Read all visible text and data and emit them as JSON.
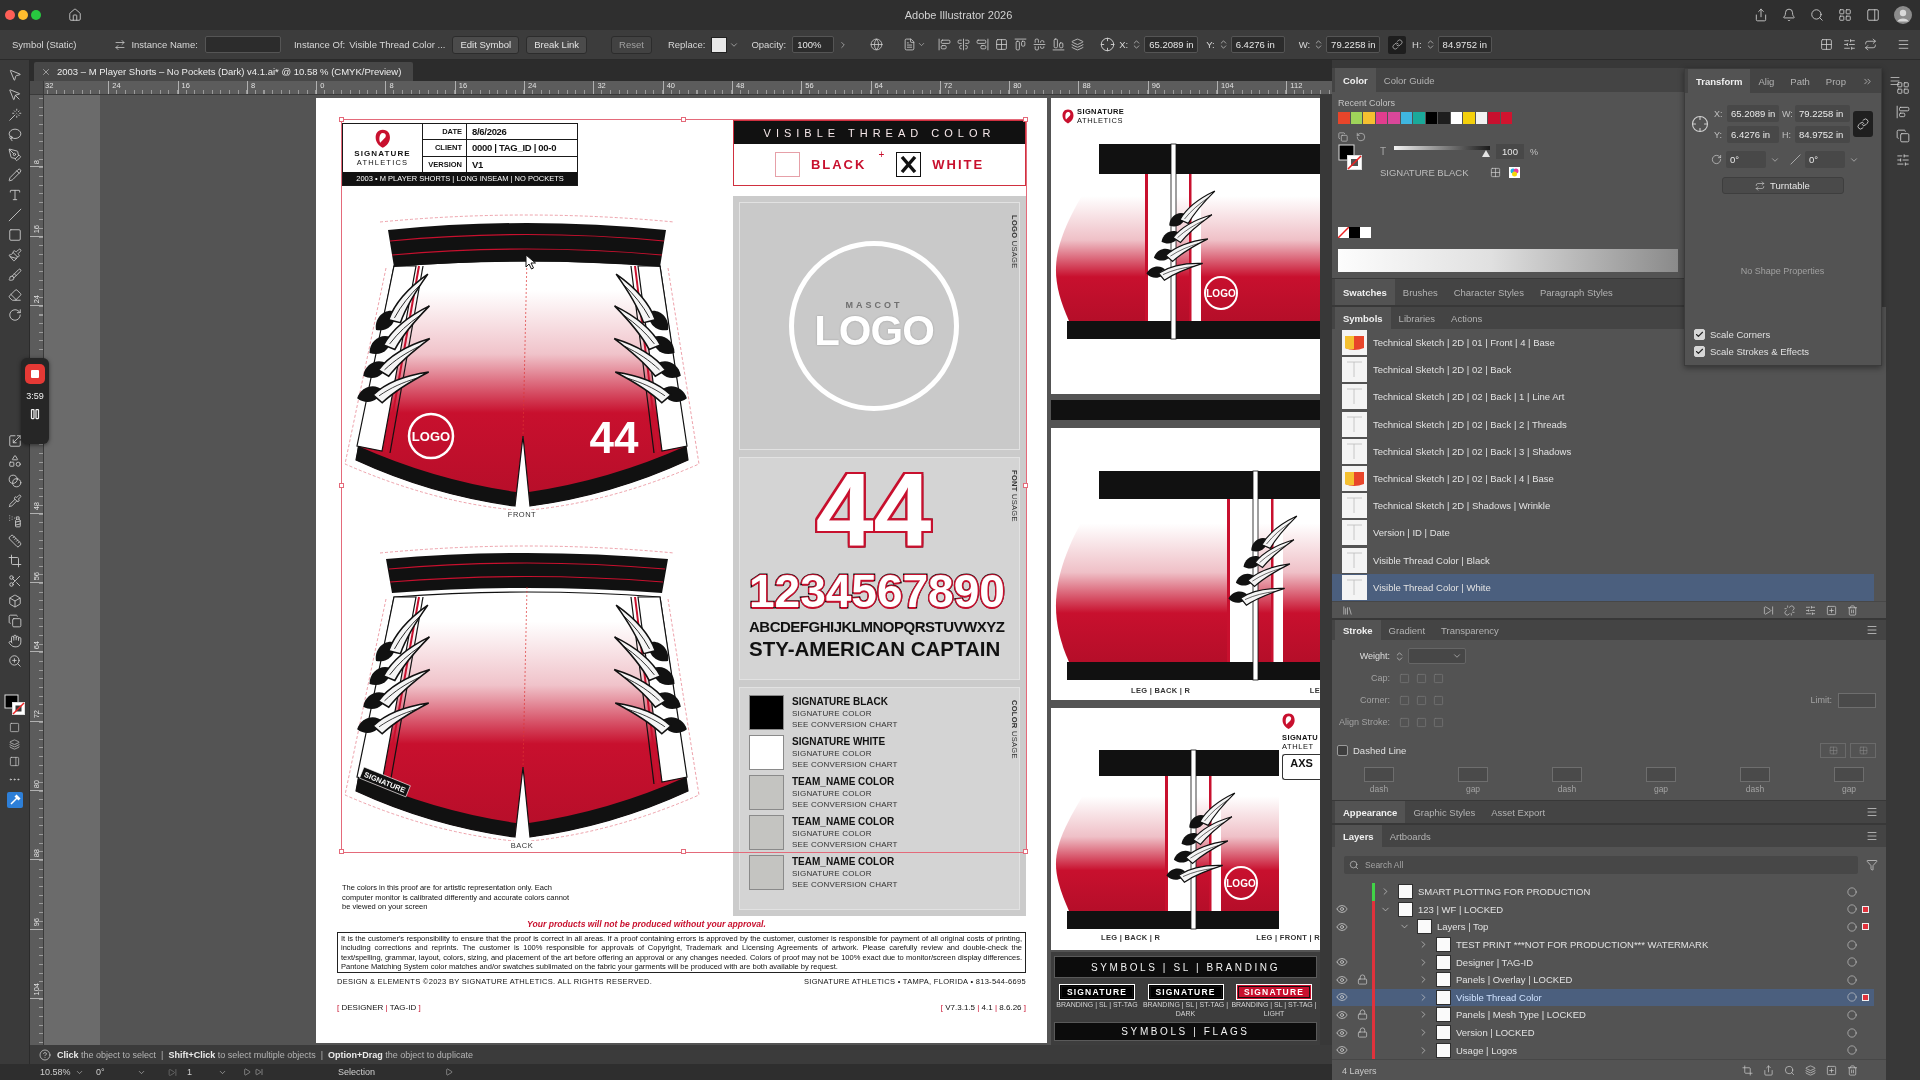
{
  "app": {
    "title": "Adobe Illustrator 2026"
  },
  "control_bar": {
    "selection_type": "Symbol (Static)",
    "instance_name_label": "Instance Name:",
    "instance_of_label": "Instance Of:",
    "instance_of": "Visible Thread Color ...",
    "buttons": [
      {
        "label": "Edit Symbol",
        "disabled": false
      },
      {
        "label": "Break Link",
        "disabled": false
      },
      {
        "label": "Reset",
        "disabled": true
      }
    ],
    "replace_label": "Replace:",
    "opacity_label": "Opacity:",
    "opacity": "100%",
    "coords": [
      {
        "label": "X:",
        "value": "65.2089 in"
      },
      {
        "label": "Y:",
        "value": "6.4276 in"
      },
      {
        "label": "W:",
        "value": "79.2258 in"
      },
      {
        "label": "H:",
        "value": "84.9752 in"
      }
    ],
    "proportions_linked": true
  },
  "document_tab": {
    "title": "2003 – M Player Shorts – No Pockets (Dark) v4.1.ai* @ 10.58 % (CMYK/Preview)",
    "selected": true
  },
  "rulers": {
    "horizontal": [
      "32",
      "24",
      "16",
      "8",
      "0",
      "8",
      "16",
      "24",
      "32",
      "40",
      "48",
      "56",
      "64",
      "72",
      "80",
      "88",
      "96",
      "104",
      "112"
    ],
    "vertical_upper": [
      "8",
      "16",
      "24"
    ],
    "vertical_lower": [
      "48",
      "56",
      "64",
      "72",
      "80",
      "88",
      "96",
      "104"
    ]
  },
  "recorder": {
    "time": "3:59"
  },
  "artboard": {
    "header": {
      "brand_name": "SIGNATURE",
      "brand_sub": "ATHLETICS",
      "fields": [
        {
          "label": "DATE",
          "value": "8/6/2026"
        },
        {
          "label": "CLIENT",
          "value": "0000 | TAG_ID | 00-0"
        },
        {
          "label": "VERSION",
          "value": "V1"
        }
      ],
      "product": "2003 • M PLAYER SHORTS | LONG INSEAM | NO POCKETS"
    },
    "thread_color": {
      "title": "VISIBLE THREAD COLOR",
      "options": [
        {
          "label": "BLACK",
          "checked": false
        },
        {
          "label": "WHITE",
          "checked": true
        }
      ],
      "joiner": "+"
    },
    "sketches": [
      {
        "kind": "front",
        "label": "FRONT",
        "logo": "LOGO",
        "number": "44"
      },
      {
        "kind": "back",
        "label": "BACK",
        "tag": "SIGNATURE"
      }
    ],
    "usage": {
      "logo": {
        "label": "**LOGO** USAGE",
        "mascot": "MASCOT",
        "text": "LOGO"
      },
      "font": {
        "label": "**FONT** USAGE",
        "number": "44",
        "digits": "1234567890",
        "alphabet": "ABCDEFGHIJKLMNOPQRSTUVWXYZ",
        "name": "STY-AMERICAN CAPTAIN"
      },
      "color": {
        "label": "**COLOR** USAGE",
        "entries": [
          {
            "name": "SIGNATURE BLACK",
            "color": "#000000",
            "type": "SIGNATURE COLOR",
            "note": "SEE CONVERSION CHART"
          },
          {
            "name": "SIGNATURE WHITE",
            "color": "#ffffff",
            "type": "SIGNATURE COLOR",
            "note": "SEE CONVERSION CHART"
          },
          {
            "name": "TEAM_NAME COLOR",
            "color": "#c4c4c1",
            "type": "SIGNATURE COLOR",
            "note": "SEE CONVERSION CHART"
          },
          {
            "name": "TEAM_NAME COLOR",
            "color": "#c4c4c1",
            "type": "SIGNATURE COLOR",
            "note": "SEE CONVERSION CHART"
          },
          {
            "name": "TEAM_NAME COLOR",
            "color": "#c4c4c1",
            "type": "SIGNATURE COLOR",
            "note": "SEE CONVERSION CHART"
          }
        ]
      }
    },
    "note": "The colors in this proof are for artistic representation only. Each computer monitor is calibrated differently and accurate colors cannot be viewed on your screen",
    "approval": "Your products will not be produced without your approval.",
    "disclaimer": "It is the customer's responsibility to ensure that the proof is correct in all areas. If a proof containing errors is approved by the customer, customer is responsible for payment of all original costs of printing, including corrections and reprints. The customer is 100% responsible for approvals of Copyright, Trademark and Licensing Agreements of artwork. Please carefully review and double-check the text/spelling, grammar, layout, colors, sizing, and placement of the art before offering an approval or any changes needed.  Colors of proof may not be 100% exact due to monitor/screen display differences. Pantone Matching System color matches and/or swatches sublimated on the fabric your garments will be produced with are both available by request.",
    "rights": "DESIGN & ELEMENTS ©2023 BY SIGNATURE ATHLETICS. ALL RIGHTS RESERVED.",
    "contact": "SIGNATURE ATHLETICS • TAMPA, FLORIDA • 813-544-6695",
    "designer_tag": {
      "open": "[",
      "close": "]",
      "separator": "|",
      "parts": [
        "DESIGNER",
        "TAG-ID"
      ]
    },
    "version_tag": {
      "open": "[",
      "close": "]",
      "separator": "|",
      "parts": [
        "V7.3.1.5",
        "4.1",
        "8.6.26"
      ]
    }
  },
  "previews": [
    {
      "kind": "front",
      "brand_name": "SIGNATURE",
      "brand_sub": "ATHLETICS",
      "logo": "LOGO"
    },
    {
      "kind": "back",
      "labels": [
        "LEG | BACK | R",
        "LE"
      ]
    },
    {
      "kind": "pair",
      "brand_name": "SIGNATU",
      "brand_sub": "ATHLET",
      "badge": "AXS",
      "logo": "LOGO",
      "labels": [
        "LEG | BACK | R",
        "LEG | FRONT | R"
      ]
    }
  ],
  "symbol_sheet": {
    "branding_title": "SYMBOLS | SL | BRANDING",
    "badges": [
      {
        "text": "SIGNATURE",
        "color": "#000000",
        "caption": "BRANDING | SL | ST-TAG"
      },
      {
        "text": "SIGNATURE",
        "color": "#000000",
        "caption": "BRANDING | SL | ST-TAG | DARK"
      },
      {
        "text": "SIGNATURE",
        "color": "#c8102e",
        "caption": "BRANDING | SL | ST-TAG | LIGHT"
      }
    ],
    "flags_title": "SYMBOLS | FLAGS"
  },
  "hint_bar": {
    "text": "**Click** the object to select  |  **Shift+Click** to select multiple objects  |  **Option+Drag** the object to duplicate"
  },
  "status_bar": {
    "zoom": "10.58%",
    "rotation": "0°",
    "artboard": "1",
    "tool": "Selection"
  },
  "color_panel": {
    "tabs": [
      {
        "label": "Color",
        "selected": true
      },
      {
        "label": "Color Guide",
        "selected": false
      }
    ],
    "recent_label": "Recent Colors",
    "recent_colors": [
      {
        "color": "#e8452a"
      },
      {
        "color": "#9fd35a"
      },
      {
        "color": "#f5c030"
      },
      {
        "color": "#e23d8e"
      },
      {
        "color": "#d9479a"
      },
      {
        "color": "#3fb6e0"
      },
      {
        "color": "#1aa99a"
      },
      {
        "color": "#000000"
      },
      {
        "color": "#1e1e1e"
      },
      {
        "color": "#ffffff"
      },
      {
        "color": "#f4d00c"
      },
      {
        "color": "#f2f2f2"
      },
      {
        "color": "#c8102e"
      },
      {
        "color": "#d0142f"
      }
    ],
    "tint": {
      "label": "T",
      "level": 1,
      "value": "100",
      "unit": "%"
    },
    "swatch_name": "SIGNATURE BLACK"
  },
  "swatches_tabs": [
    {
      "label": "Swatches",
      "selected": true
    },
    {
      "label": "Brushes",
      "selected": false
    },
    {
      "label": "Character Styles",
      "selected": false
    },
    {
      "label": "Paragraph Styles",
      "selected": false
    }
  ],
  "symbols_panel": {
    "tabs": [
      {
        "label": "Symbols",
        "selected": true
      },
      {
        "label": "Libraries",
        "selected": false
      },
      {
        "label": "Actions",
        "selected": false
      }
    ],
    "items": [
      {
        "name": "Technical Sketch | 2D | 01 | Front | 4 | Base",
        "kind": "color",
        "selected": false
      },
      {
        "name": "Technical Sketch | 2D | 02 | Back",
        "kind": "sketch",
        "selected": false
      },
      {
        "name": "Technical Sketch | 2D | 02 | Back | 1 | Line Art",
        "kind": "sketch",
        "selected": false
      },
      {
        "name": "Technical Sketch | 2D | 02 | Back | 2 | Threads",
        "kind": "sketch",
        "selected": false
      },
      {
        "name": "Technical Sketch | 2D | 02 | Back | 3 | Shadows",
        "kind": "sketch",
        "selected": false
      },
      {
        "name": "Technical Sketch | 2D | 02 | Back | 4 | Base",
        "kind": "color",
        "selected": false
      },
      {
        "name": "Technical Sketch | 2D | Shadows | Wrinkle",
        "kind": "sketch",
        "selected": false
      },
      {
        "name": "Version | ID | Date",
        "kind": "sketch",
        "selected": false
      },
      {
        "name": "Visible Thread Color | Black",
        "kind": "sketch",
        "selected": false
      },
      {
        "name": "Visible Thread Color | White",
        "kind": "sketch",
        "selected": true
      }
    ]
  },
  "transform_panel": {
    "tabs": [
      {
        "label": "Transform",
        "selected": true
      },
      {
        "label": "Alig",
        "selected": false
      },
      {
        "label": "Path",
        "selected": false
      },
      {
        "label": "Prop",
        "selected": false
      }
    ],
    "fields": [
      {
        "label": "X:",
        "value": "65.2089 in"
      },
      {
        "label": "W:",
        "value": "79.2258 in"
      },
      {
        "label": "Y:",
        "value": "6.4276 in"
      },
      {
        "label": "H:",
        "value": "84.9752 in"
      }
    ],
    "proportions_linked": true,
    "angle": "0°",
    "shear": "0°",
    "turntable": "Turntable",
    "empty_note": "No Shape Properties",
    "options": [
      {
        "label": "Scale Corners",
        "checked": true
      },
      {
        "label": "Scale Strokes & Effects",
        "checked": true
      }
    ]
  },
  "stroke_panel": {
    "tabs": [
      {
        "label": "Stroke",
        "selected": true
      },
      {
        "label": "Gradient",
        "selected": false
      },
      {
        "label": "Transparency",
        "selected": false
      }
    ],
    "weight_label": "Weight:",
    "rows": [
      {
        "label": "Cap:",
        "disabled": true
      },
      {
        "label": "Corner:",
        "disabled": true
      },
      {
        "label": "Align Stroke:",
        "disabled": true
      }
    ],
    "limit": {
      "label": "Limit:",
      "disabled": true
    },
    "dashed": {
      "label": "Dashed Line",
      "checked": false
    },
    "dash_fields": [
      {
        "label": "dash",
        "disabled": true
      },
      {
        "label": "gap",
        "disabled": true
      },
      {
        "label": "dash",
        "disabled": true
      },
      {
        "label": "gap",
        "disabled": true
      },
      {
        "label": "dash",
        "disabled": true
      },
      {
        "label": "gap",
        "disabled": true
      }
    ]
  },
  "appearance_tabs": [
    {
      "label": "Appearance",
      "selected": true
    },
    {
      "label": "Graphic Styles",
      "selected": false
    },
    {
      "label": "Asset Export",
      "selected": false
    }
  ],
  "layers_panel": {
    "tabs": [
      {
        "label": "Layers",
        "selected": true
      },
      {
        "label": "Artboards",
        "selected": false
      }
    ],
    "search_placeholder": "Search All",
    "layers": [
      {
        "name": "SMART PLOTTING FOR PRODUCTION",
        "color": "#41d447",
        "visible": false,
        "locked": false,
        "expanded": false,
        "selected": false,
        "selection_mark": false
      },
      {
        "name": "123 | WF | LOCKED",
        "color": "#e0323c",
        "visible": true,
        "locked": false,
        "expanded": true,
        "selected": false,
        "selection_mark": true,
        "children": [
          {
            "name": "Layers | Top",
            "visible": true,
            "locked": false,
            "expanded": true,
            "selected": false,
            "selection_mark": true,
            "children": [
              {
                "name": "TEST PRINT ***NOT FOR PRODUCTION*** WATERMARK",
                "visible": false,
                "locked": false,
                "expanded": false,
                "selected": false,
                "selection_mark": false
              },
              {
                "name": "Designer | TAG-ID",
                "visible": true,
                "locked": false,
                "expanded": false,
                "selected": false,
                "selection_mark": false
              },
              {
                "name": "Panels | Overlay | LOCKED",
                "visible": true,
                "locked": true,
                "expanded": false,
                "selected": false,
                "selection_mark": false
              },
              {
                "name": "Visible Thread Color",
                "visible": true,
                "locked": false,
                "expanded": false,
                "selected": true,
                "selection_mark": true
              },
              {
                "name": "Panels | Mesh Type | LOCKED",
                "visible": true,
                "locked": true,
                "expanded": false,
                "selected": false,
                "selection_mark": false
              },
              {
                "name": "Version | LOCKED",
                "visible": true,
                "locked": true,
                "expanded": false,
                "selected": false,
                "selection_mark": false
              },
              {
                "name": "Usage | Logos",
                "visible": true,
                "locked": false,
                "expanded": false,
                "selected": false,
                "selection_mark": false
              }
            ]
          }
        ]
      }
    ],
    "count": "4 Layers"
  }
}
